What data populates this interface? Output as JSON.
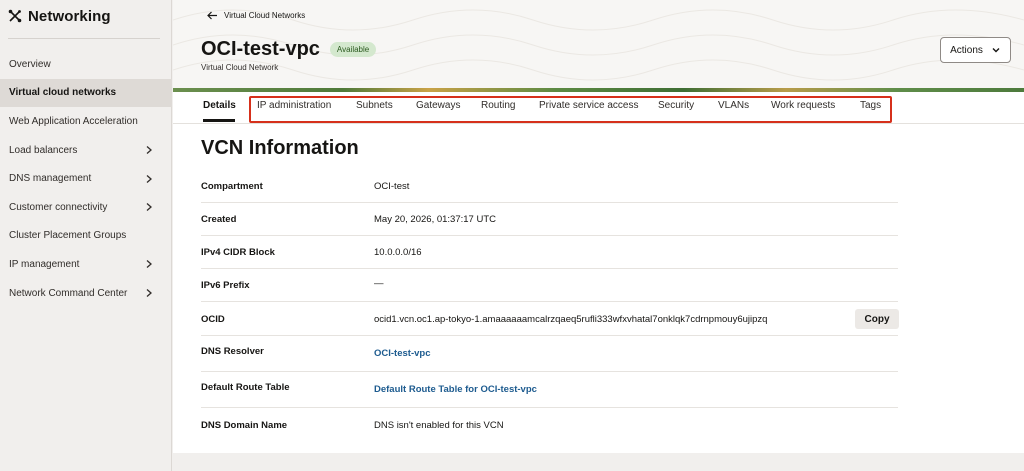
{
  "sidebar": {
    "title": "Networking",
    "items": [
      {
        "label": "Overview",
        "chevron": false,
        "active": false
      },
      {
        "label": "Virtual cloud networks",
        "chevron": false,
        "active": true
      },
      {
        "label": "Web Application Acceleration",
        "chevron": false,
        "active": false
      },
      {
        "label": "Load balancers",
        "chevron": true,
        "active": false
      },
      {
        "label": "DNS management",
        "chevron": true,
        "active": false
      },
      {
        "label": "Customer connectivity",
        "chevron": true,
        "active": false
      },
      {
        "label": "Cluster Placement Groups",
        "chevron": false,
        "active": false
      },
      {
        "label": "IP management",
        "chevron": true,
        "active": false
      },
      {
        "label": "Network Command Center",
        "chevron": true,
        "active": false
      }
    ]
  },
  "header": {
    "back_label": "Virtual Cloud Networks",
    "title": "OCI-test-vpc",
    "status": "Available",
    "subtitle": "Virtual Cloud Network",
    "actions_label": "Actions"
  },
  "tabs": [
    {
      "label": "Details",
      "active": true
    },
    {
      "label": "IP administration",
      "active": false
    },
    {
      "label": "Subnets",
      "active": false
    },
    {
      "label": "Gateways",
      "active": false
    },
    {
      "label": "Routing",
      "active": false
    },
    {
      "label": "Private service access",
      "active": false
    },
    {
      "label": "Security",
      "active": false
    },
    {
      "label": "VLANs",
      "active": false
    },
    {
      "label": "Work requests",
      "active": false
    },
    {
      "label": "Tags",
      "active": false
    }
  ],
  "section": {
    "title": "VCN Information",
    "rows": [
      {
        "label": "Compartment",
        "value": "OCI-test",
        "link": false
      },
      {
        "label": "Created",
        "value": "May 20, 2026, 01:37:17 UTC",
        "link": false
      },
      {
        "label": "IPv4 CIDR Block",
        "value": "10.0.0.0/16",
        "link": false
      },
      {
        "label": "IPv6 Prefix",
        "value": "—",
        "link": false
      },
      {
        "label": "OCID",
        "value": "ocid1.vcn.oc1.ap-tokyo-1.amaaaaaamcalrzqaeq5rufli333wfxvhatal7onklqk7cdrnpmouy6ujipzq",
        "link": false,
        "copy": "Copy"
      },
      {
        "label": "DNS Resolver",
        "value": "OCI-test-vpc",
        "link": true
      },
      {
        "label": "Default Route Table",
        "value": "Default Route Table for OCI-test-vpc",
        "link": true
      },
      {
        "label": "DNS Domain Name",
        "value": "DNS isn't enabled for this VCN",
        "link": false
      }
    ]
  },
  "colors": {
    "accent_link": "#1d5b8f",
    "highlight_box": "#d6301b",
    "status_badge": "#d4e8ce"
  }
}
